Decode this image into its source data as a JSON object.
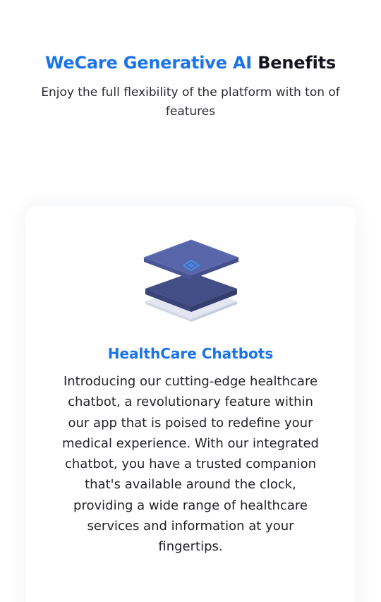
{
  "benefits": {
    "title_accent": "WeCare Generative AI",
    "title_rest": "Benefits",
    "subtitle": "Enjoy the full flexibility of the platform with ton of features"
  },
  "feature_card": {
    "icon": "layered-stack-icon",
    "title": "HealthCare Chatbots",
    "description": "Introducing our cutting-edge healthcare chatbot, a revolutionary feature within our app that is poised to redefine your medical experience. With our integrated chatbot, you have a trusted companion that's available around the clock, providing a wide range of healthcare services and information at your fingertips."
  },
  "colors": {
    "accent": "#1a73e8",
    "heading_dark": "#14141f",
    "icon_top": "#5865a8",
    "icon_bottom": "#434d86",
    "icon_base": "#e3e6f1"
  }
}
